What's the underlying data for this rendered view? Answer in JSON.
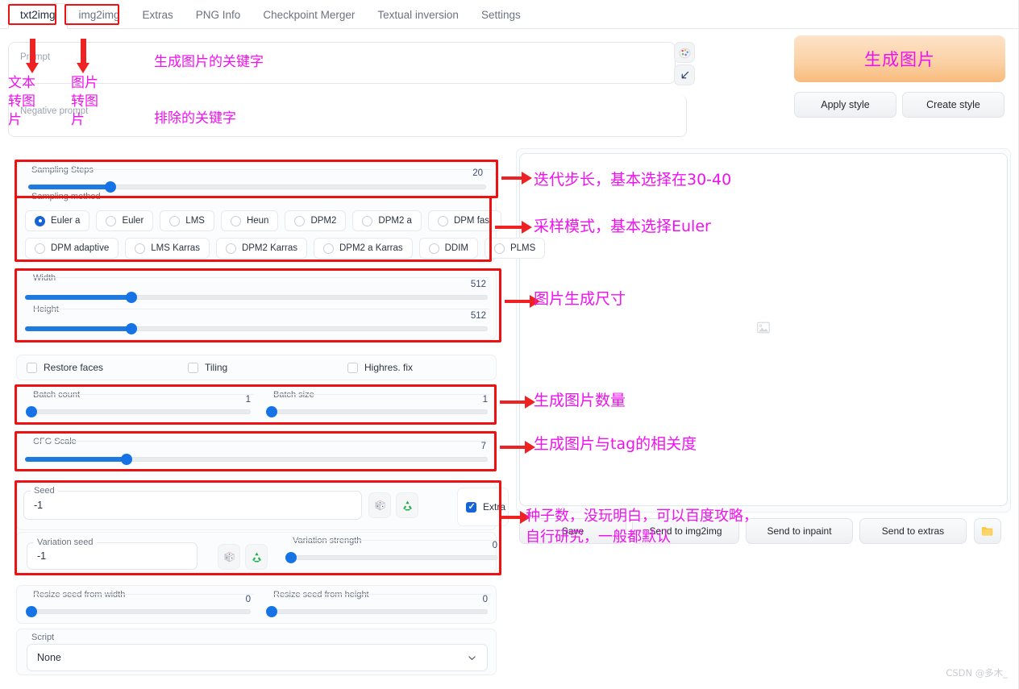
{
  "tabs": [
    {
      "label": "txt2img",
      "active": true
    },
    {
      "label": "img2img",
      "active": false
    },
    {
      "label": "Extras",
      "active": false
    },
    {
      "label": "PNG Info",
      "active": false
    },
    {
      "label": "Checkpoint Merger",
      "active": false
    },
    {
      "label": "Textual inversion",
      "active": false
    },
    {
      "label": "Settings",
      "active": false
    }
  ],
  "prompt": {
    "placeholder": "Prompt",
    "value": "",
    "negative_placeholder": "Negative prompt",
    "negative_value": "",
    "palette_icon": "palette-icon",
    "arrow_icon": "arrow-down-left-icon"
  },
  "generate": {
    "label": "生成图片",
    "apply_style": "Apply style",
    "create_style": "Create style",
    "color": "#f8bb7c"
  },
  "sampling_steps": {
    "label": "Sampling Steps",
    "value": "20",
    "percent": 18
  },
  "sampling_method": {
    "label": "Sampling method",
    "selected": "Euler a",
    "row1": [
      "Euler a",
      "Euler",
      "LMS",
      "Heun",
      "DPM2",
      "DPM2 a",
      "DPM fast"
    ],
    "row2": [
      "DPM adaptive",
      "LMS Karras",
      "DPM2 Karras",
      "DPM2 a Karras",
      "DDIM",
      "PLMS"
    ]
  },
  "width": {
    "label": "Width",
    "value": "512",
    "percent": 23
  },
  "height": {
    "label": "Height",
    "value": "512",
    "percent": 23
  },
  "checkboxes": [
    {
      "label": "Restore faces",
      "checked": false
    },
    {
      "label": "Tiling",
      "checked": false
    },
    {
      "label": "Highres. fix",
      "checked": false
    }
  ],
  "batch_count": {
    "label": "Batch count",
    "value": "1",
    "percent": 0
  },
  "batch_size": {
    "label": "Batch size",
    "value": "1",
    "percent": 0
  },
  "cfg_scale": {
    "label": "CFG Scale",
    "value": "7",
    "percent": 22
  },
  "seed": {
    "label": "Seed",
    "value": "-1",
    "dice_icon": "dice-icon",
    "recycle_icon": "recycle-icon",
    "extra_label": "Extra",
    "extra_checked": true
  },
  "variation_seed": {
    "label": "Variation seed",
    "value": "-1",
    "dice_icon": "dice-icon",
    "recycle_icon": "recycle-icon"
  },
  "variation_strength": {
    "label": "Variation strength",
    "value": "0",
    "percent": 0
  },
  "resize_seed_width": {
    "label": "Resize seed from width",
    "value": "0",
    "percent": 0
  },
  "resize_seed_height": {
    "label": "Resize seed from height",
    "value": "0",
    "percent": 0
  },
  "script": {
    "label": "Script",
    "value": "None",
    "chevron": "chevron-down-icon"
  },
  "gallery": {
    "placeholder_icon": "image-placeholder-icon"
  },
  "actions": [
    {
      "label": "Save"
    },
    {
      "label": "Send to img2img"
    },
    {
      "label": "Send to inpaint"
    },
    {
      "label": "Send to extras"
    }
  ],
  "folder_icon": "folder-icon",
  "annotations": {
    "txt2img_note": "文本\n转图\n片",
    "img2img_note": "图片\n转图\n片",
    "prompt_note": "生成图片的关键字",
    "negative_note": "排除的关键字",
    "steps_note": "迭代步长，基本选择在30-40",
    "method_note": "采样模式，基本选择Euler",
    "size_note": "图片生成尺寸",
    "batch_note": "生成图片数量",
    "cfg_note": "生成图片与tag的相关度",
    "seed_note": "种子数，没玩明白，可以百度攻略，\n自行研究，一般都默认"
  },
  "watermark": "CSDN @多木_"
}
